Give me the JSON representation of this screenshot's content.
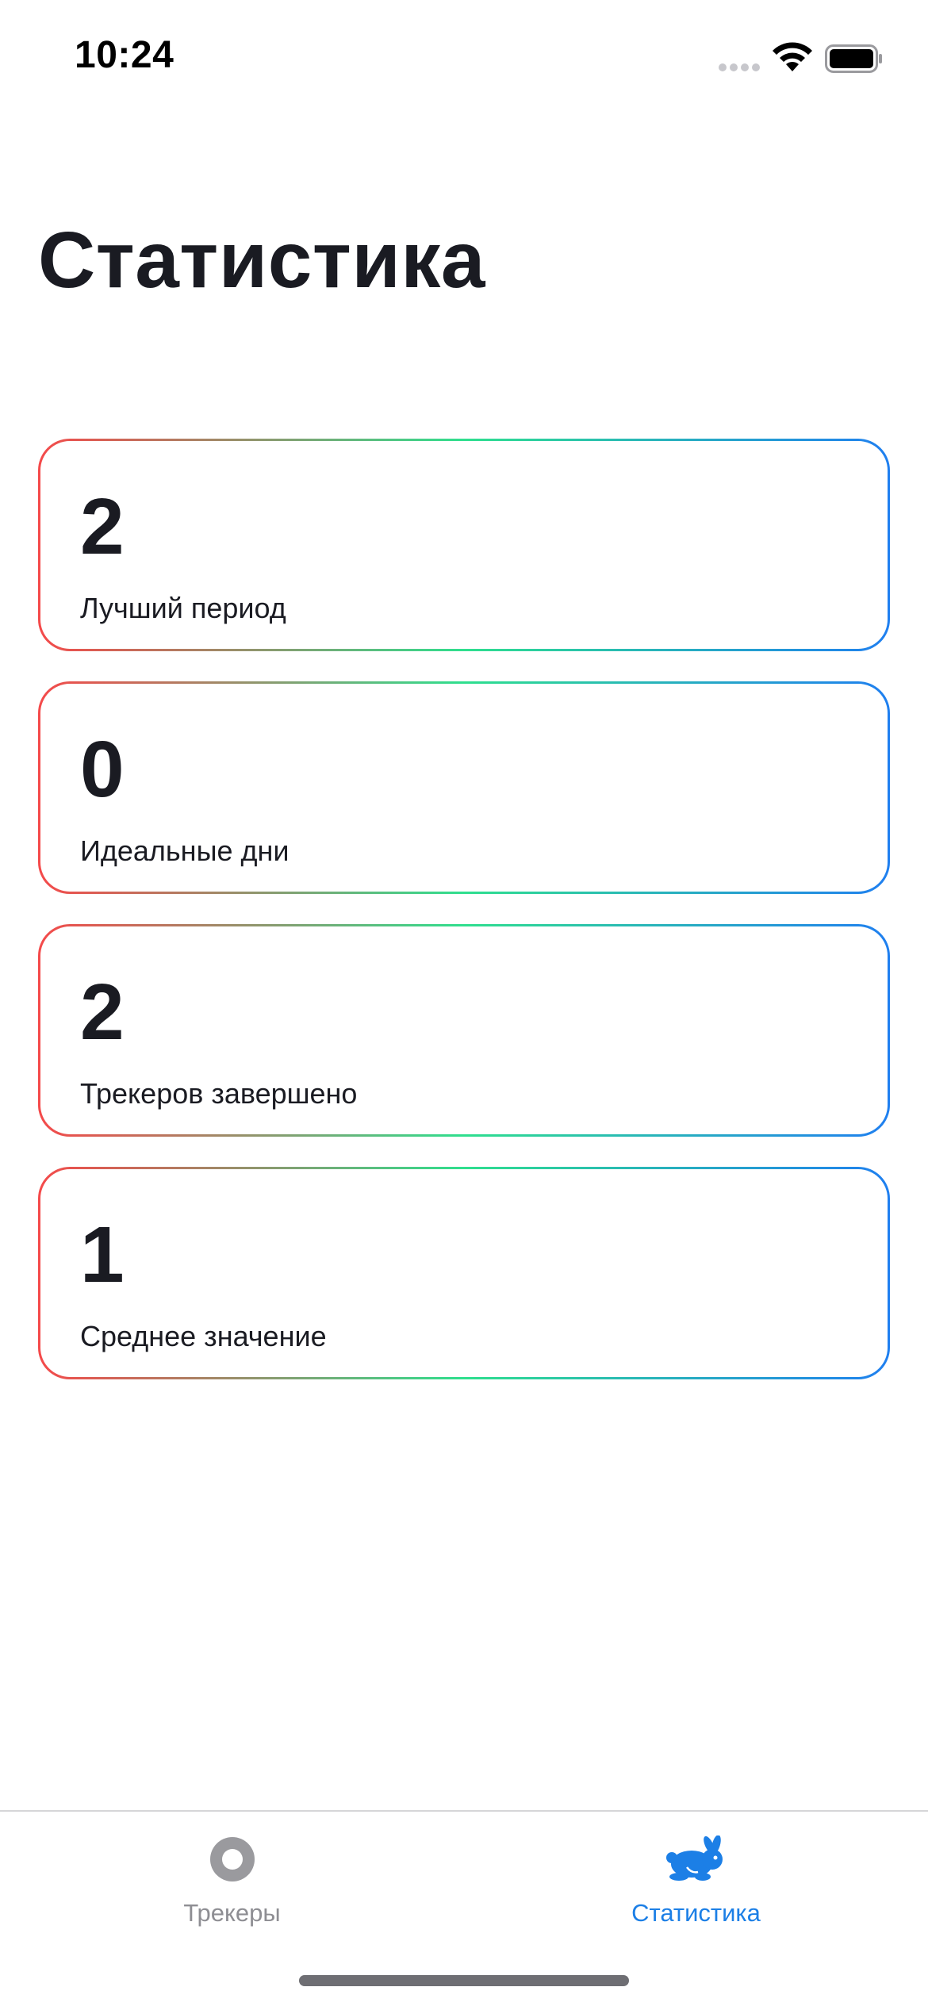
{
  "status_bar": {
    "time": "10:24"
  },
  "page": {
    "title": "Статистика"
  },
  "stats": [
    {
      "value": "2",
      "label": "Лучший период"
    },
    {
      "value": "0",
      "label": "Идеальные дни"
    },
    {
      "value": "2",
      "label": "Трекеров завершено"
    },
    {
      "value": "1",
      "label": "Среднее значение"
    }
  ],
  "tab_bar": {
    "tabs": [
      {
        "label": "Трекеры",
        "icon": "trackers-icon",
        "active": false
      },
      {
        "label": "Статистика",
        "icon": "rabbit-icon",
        "active": true
      }
    ]
  },
  "colors": {
    "accent": "#1C7FE6",
    "inactive": "#8E8E93",
    "text": "#1A1B22",
    "gradient_start": "#F5494A",
    "gradient_mid": "#2FDF8E",
    "gradient_end": "#1F7FF0"
  }
}
